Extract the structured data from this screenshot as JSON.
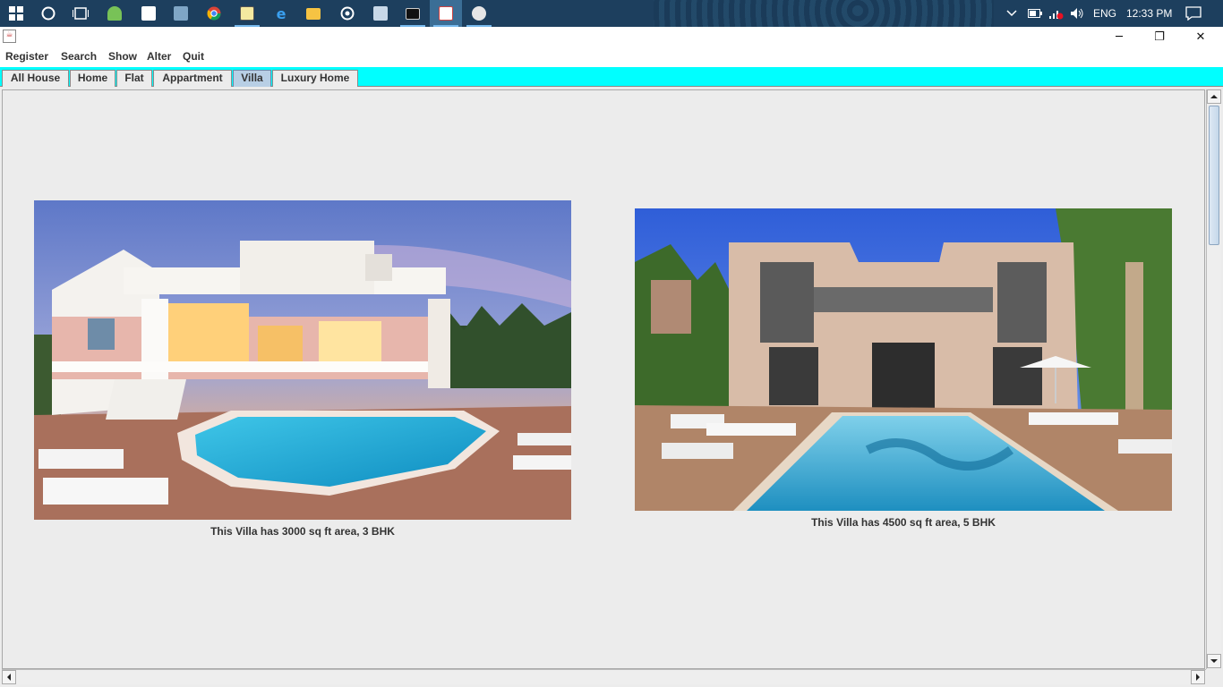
{
  "taskbar": {
    "icons": [
      "windows-start-icon",
      "cortana-icon",
      "task-view-icon",
      "android-studio-icon",
      "store-icon",
      "photos-icon",
      "chrome-icon",
      "notepad-icon",
      "edge-icon",
      "file-explorer-icon",
      "media-icon",
      "notes-icon",
      "cmd-icon",
      "java-app-icon",
      "misc-app-icon"
    ],
    "language": "ENG",
    "time": "12:33 PM"
  },
  "window": {
    "minimize": "─",
    "restore": "❐",
    "close": "✕"
  },
  "menu": {
    "items": [
      "Register",
      "Search",
      "Show",
      "Alter",
      "Quit"
    ]
  },
  "tabs": {
    "items": [
      "All House",
      "Home",
      "Flat",
      "Appartment",
      "Villa",
      "Luxury Home"
    ],
    "selected": "Villa"
  },
  "listings": [
    {
      "caption": "This Villa has 3000 sq ft area, 3 BHK"
    },
    {
      "caption": "This Villa has 4500 sq ft area, 5 BHK"
    }
  ],
  "colors": {
    "tabbar_bg": "#00ffff",
    "taskbar_bg": "#1d3f5e",
    "selected_tab": "#b8cfe5"
  }
}
